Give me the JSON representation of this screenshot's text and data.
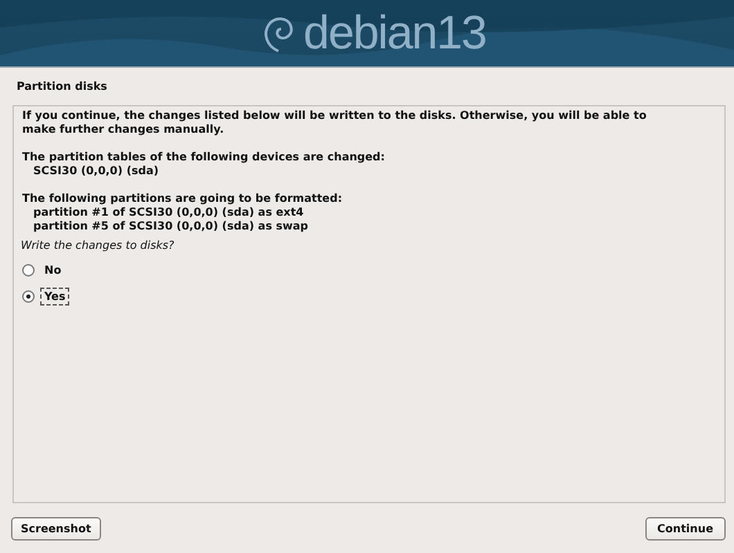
{
  "banner": {
    "logo_text": "debian",
    "version": "13"
  },
  "title": "Partition disks",
  "message": {
    "intro": "If you continue, the changes listed below will be written to the disks. Otherwise, you will be able to make further changes manually.",
    "sections": [
      {
        "heading": "The partition tables of the following devices are changed:",
        "items": [
          "SCSI30 (0,0,0) (sda)"
        ]
      },
      {
        "heading": "The following partitions are going to be formatted:",
        "items": [
          "partition #1 of SCSI30 (0,0,0) (sda) as ext4",
          "partition #5 of SCSI30 (0,0,0) (sda) as swap"
        ]
      }
    ]
  },
  "question": "Write the changes to disks?",
  "options": [
    {
      "label": "No",
      "selected": false,
      "focused": false
    },
    {
      "label": "Yes",
      "selected": true,
      "focused": true
    }
  ],
  "buttons": [
    {
      "label": "Screenshot",
      "kind": "left"
    },
    {
      "label": "Continue",
      "kind": "right"
    }
  ]
}
